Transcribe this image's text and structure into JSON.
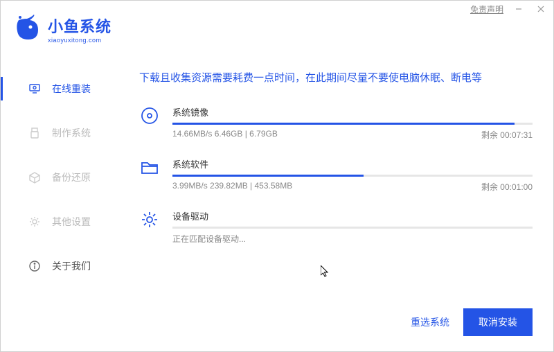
{
  "titlebar": {
    "disclaimer": "免责声明",
    "minimize": "—",
    "close": "×"
  },
  "logo": {
    "title": "小鱼系统",
    "subtitle": "xiaoyuxitong.com"
  },
  "sidebar": {
    "items": [
      {
        "label": "在线重装"
      },
      {
        "label": "制作系统"
      },
      {
        "label": "备份还原"
      },
      {
        "label": "其他设置"
      },
      {
        "label": "关于我们"
      }
    ]
  },
  "main": {
    "message": "下载且收集资源需要耗费一点时间，在此期间尽量不要使电脑休眠、断电等",
    "tasks": [
      {
        "title": "系统镜像",
        "progress_pct": 95,
        "stats": "14.66MB/s 6.46GB | 6.79GB",
        "remaining": "剩余 00:07:31"
      },
      {
        "title": "系统软件",
        "progress_pct": 53,
        "stats": "3.99MB/s 239.82MB | 453.58MB",
        "remaining": "剩余 00:01:00"
      },
      {
        "title": "设备驱动",
        "status": "正在匹配设备驱动..."
      }
    ]
  },
  "footer": {
    "reselect": "重选系统",
    "cancel": "取消安装"
  }
}
